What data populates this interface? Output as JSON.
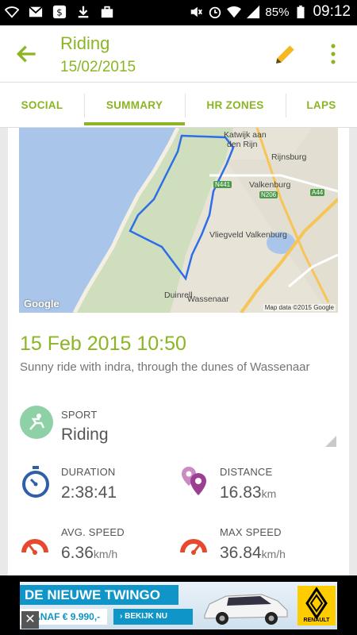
{
  "status_bar": {
    "battery": "85%",
    "time": "09:12"
  },
  "app_bar": {
    "title": "Riding",
    "subtitle": "15/02/2015"
  },
  "tabs": [
    {
      "label": "SOCIAL"
    },
    {
      "label": "SUMMARY",
      "selected": true
    },
    {
      "label": "HR ZONES"
    },
    {
      "label": "LAPS"
    }
  ],
  "map": {
    "places": [
      "Katwijk aan",
      "den Rijn",
      "Rijnsburg",
      "Valkenburg",
      "Vliegveld Valkenburg",
      "Wassenaar",
      "Duinrell"
    ],
    "roads": [
      "N441",
      "N206",
      "A44"
    ],
    "google_logo": "Google",
    "attribution": "Map data ©2015 Google"
  },
  "activity": {
    "datetime": "15 Feb 2015 10:50",
    "description": "Sunny ride with indra, through the dunes of Wassenaar"
  },
  "sport": {
    "label": "SPORT",
    "value": "Riding"
  },
  "stats": {
    "duration": {
      "label": "DURATION",
      "value": "2:38:41"
    },
    "distance": {
      "label": "DISTANCE",
      "value": "16.83",
      "unit": "km"
    },
    "avg_speed": {
      "label": "AVG. SPEED",
      "value": "6.36",
      "unit": "km/h"
    },
    "max_speed": {
      "label": "MAX SPEED",
      "value": "36.84",
      "unit": "km/h"
    }
  },
  "colors": {
    "accent": "#8bb524",
    "icon_blue": "#2f5fa8",
    "icon_purple": "#9b3f92",
    "icon_red": "#e64a2e",
    "sport_green": "#8fd1a7"
  },
  "ad": {
    "headline": "DE NIEUWE TWINGO",
    "price": "VANAF € 9.990,-",
    "cta": "› BEKIJK NU",
    "brand": "RENAULT",
    "close": "✕"
  }
}
